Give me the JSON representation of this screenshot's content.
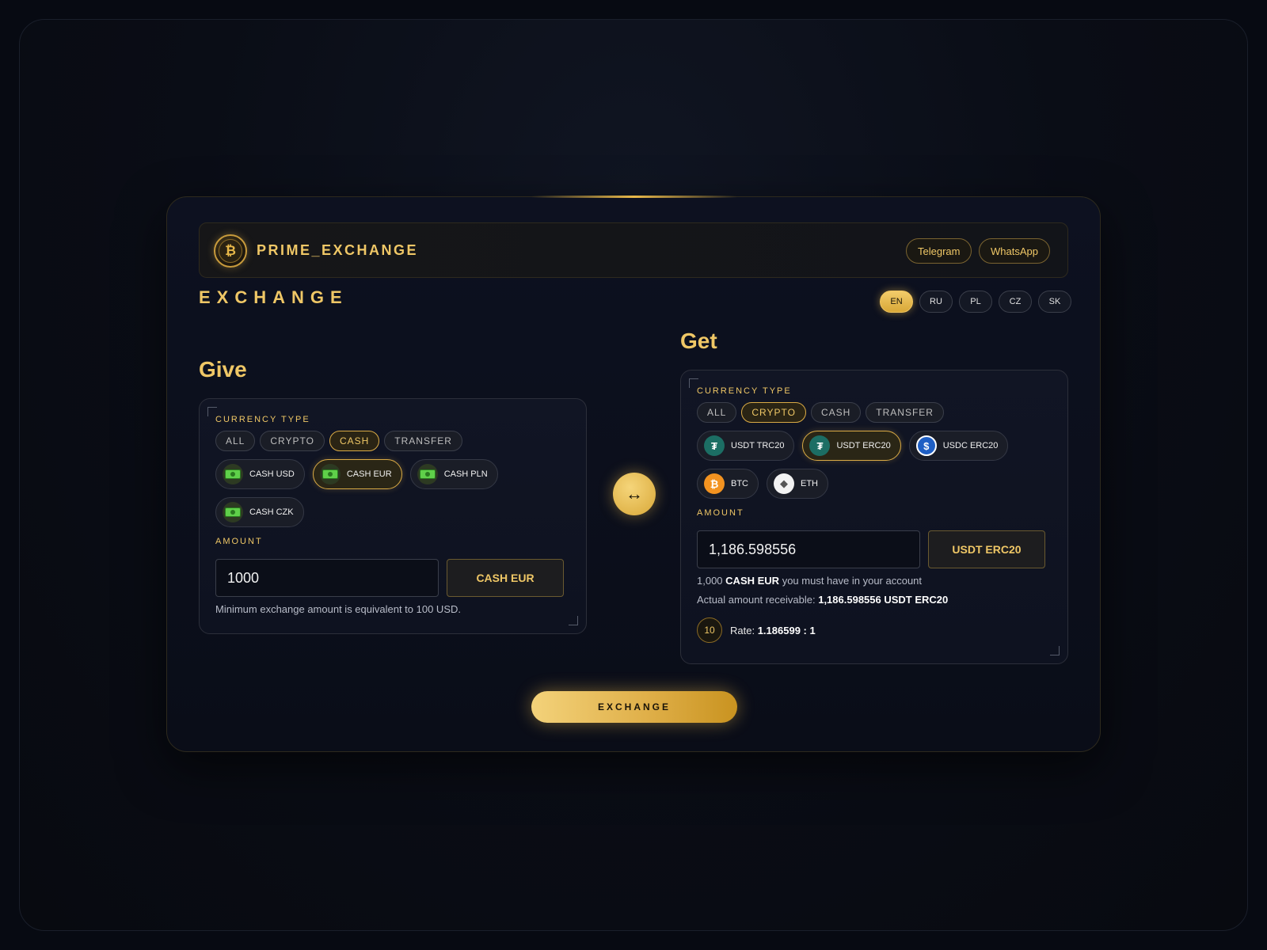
{
  "brand": {
    "name": "PRIME_EXCHANGE",
    "logo_glyph": "₿"
  },
  "header": {
    "telegram": "Telegram",
    "whatsapp": "WhatsApp"
  },
  "page_title": "EXCHANGE",
  "languages": {
    "items": [
      "EN",
      "RU",
      "PL",
      "CZ",
      "SK"
    ],
    "active": "EN"
  },
  "give": {
    "heading": "Give",
    "currency_type_label": "CURRENCY TYPE",
    "filters": [
      "ALL",
      "CRYPTO",
      "CASH",
      "TRANSFER"
    ],
    "active_filter": "CASH",
    "currencies": [
      {
        "label": "CASH USD",
        "icon": "cash-icon",
        "selected": false
      },
      {
        "label": "CASH EUR",
        "icon": "cash-icon",
        "selected": true
      },
      {
        "label": "CASH PLN",
        "icon": "cash-icon",
        "selected": false
      },
      {
        "label": "CASH CZK",
        "icon": "cash-icon",
        "selected": false
      }
    ],
    "amount_label": "AMOUNT",
    "amount_value": "1000",
    "currency_button": "CASH EUR",
    "min_note": "Minimum exchange amount is equivalent to 100 USD."
  },
  "get": {
    "heading": "Get",
    "currency_type_label": "CURRENCY TYPE",
    "filters": [
      "ALL",
      "CRYPTO",
      "CASH",
      "TRANSFER"
    ],
    "active_filter": "CRYPTO",
    "currencies": [
      {
        "label": "USDT TRC20",
        "icon": "tether-icon",
        "selected": false
      },
      {
        "label": "USDT ERC20",
        "icon": "tether-icon",
        "selected": true
      },
      {
        "label": "USDC ERC20",
        "icon": "usdc-icon",
        "selected": false
      },
      {
        "label": "BTC",
        "icon": "bitcoin-icon",
        "selected": false
      },
      {
        "label": "ETH",
        "icon": "ethereum-icon",
        "selected": false
      }
    ],
    "amount_label": "AMOUNT",
    "amount_value": "1,186.598556",
    "currency_button": "USDT ERC20",
    "must_have_amount": "1,000",
    "must_have_currency": "CASH EUR",
    "must_have_suffix": "you must have in your account",
    "receivable_prefix": "Actual amount receivable:",
    "receivable_value": "1,186.598556 USDT ERC20",
    "rate_badge": "10",
    "rate_prefix": "Rate:",
    "rate_value": "1.186599 : 1"
  },
  "swap_glyph": "↔",
  "exchange_button": "EXCHANGE",
  "colors": {
    "accent": "#efc766",
    "background": "#0a0d18",
    "border": "#2e2a1e"
  }
}
